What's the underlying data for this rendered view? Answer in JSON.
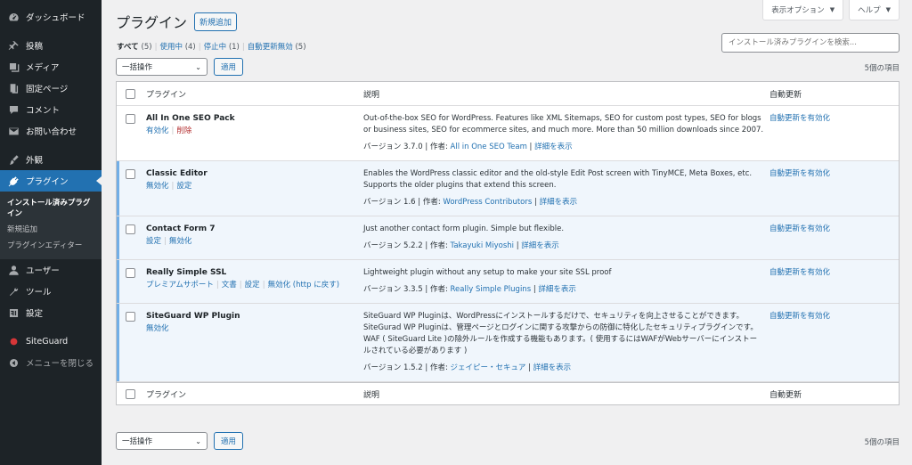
{
  "sidebar": {
    "items": [
      {
        "label": "ダッシュボード",
        "icon": "dashboard-icon"
      },
      {
        "label": "投稿",
        "icon": "pin-icon"
      },
      {
        "label": "メディア",
        "icon": "media-icon"
      },
      {
        "label": "固定ページ",
        "icon": "page-icon"
      },
      {
        "label": "コメント",
        "icon": "comment-icon"
      },
      {
        "label": "お問い合わせ",
        "icon": "mail-icon"
      },
      {
        "label": "外観",
        "icon": "brush-icon"
      },
      {
        "label": "プラグイン",
        "icon": "plugin-icon"
      },
      {
        "label": "ユーザー",
        "icon": "user-icon"
      },
      {
        "label": "ツール",
        "icon": "wrench-icon"
      },
      {
        "label": "設定",
        "icon": "settings-icon"
      },
      {
        "label": "SiteGuard",
        "icon": "siteguard-icon"
      },
      {
        "label": "メニューを閉じる",
        "icon": "collapse-icon"
      }
    ],
    "submenu": [
      "インストール済みプラグイン",
      "新規追加",
      "プラグインエディター"
    ]
  },
  "header": {
    "screen_options": "表示オプション",
    "help": "ヘルプ",
    "title": "プラグイン",
    "add_new": "新規追加"
  },
  "filters": {
    "all": "すべて",
    "all_count": "(5)",
    "active": "使用中",
    "active_count": "(4)",
    "inactive": "停止中",
    "inactive_count": "(1)",
    "auto_disabled": "自動更新無効",
    "auto_disabled_count": "(5)"
  },
  "search": {
    "placeholder": "インストール済みプラグインを検索..."
  },
  "tablenav": {
    "bulk_action": "一括操作",
    "apply": "適用",
    "item_count": "5個の項目"
  },
  "table": {
    "headers": {
      "plugin": "プラグイン",
      "description": "説明",
      "auto_update": "自動更新"
    },
    "rows": [
      {
        "name": "All In One SEO Pack",
        "actions": [
          "有効化",
          "削除"
        ],
        "description": "Out-of-the-box SEO for WordPress. Features like XML Sitemaps, SEO for custom post types, SEO for blogs or business sites, SEO for ecommerce sites, and much more. More than 50 million downloads since 2007.",
        "version": "バージョン 3.7.0",
        "author_label": "作者:",
        "author": "All in One SEO Team",
        "details": "詳細を表示",
        "auto_update": "自動更新を有効化"
      },
      {
        "name": "Classic Editor",
        "actions": [
          "無効化",
          "設定"
        ],
        "description": "Enables the WordPress classic editor and the old-style Edit Post screen with TinyMCE, Meta Boxes, etc. Supports the older plugins that extend this screen.",
        "version": "バージョン 1.6",
        "author_label": "作者:",
        "author": "WordPress Contributors",
        "details": "詳細を表示",
        "auto_update": "自動更新を有効化"
      },
      {
        "name": "Contact Form 7",
        "actions": [
          "設定",
          "無効化"
        ],
        "description": "Just another contact form plugin. Simple but flexible.",
        "version": "バージョン 5.2.2",
        "author_label": "作者:",
        "author": "Takayuki Miyoshi",
        "details": "詳細を表示",
        "auto_update": "自動更新を有効化"
      },
      {
        "name": "Really Simple SSL",
        "actions": [
          "プレミアムサポート",
          "文書",
          "設定",
          "無効化 (http に戻す)"
        ],
        "description": "Lightweight plugin without any setup to make your site SSL proof",
        "version": "バージョン 3.3.5",
        "author_label": "作者:",
        "author": "Really Simple Plugins",
        "details": "詳細を表示",
        "auto_update": "自動更新を有効化"
      },
      {
        "name": "SiteGuard WP Plugin",
        "actions": [
          "無効化"
        ],
        "description": "SiteGuard WP Pluginは、WordPressにインストールするだけで、セキュリティを向上させることができます。SiteGurad WP Pluginは、管理ページとログインに関する攻撃からの防御に特化したセキュリティプラグインです。WAF ( SiteGuard Lite )の除外ルールを作成する機能もあります。( 使用するにはWAFがWebサーバーにインストールされている必要があります )",
        "version": "バージョン 1.5.2",
        "author_label": "作者:",
        "author": "ジェイピー・セキュア",
        "details": "詳細を表示",
        "auto_update": "自動更新を有効化"
      }
    ]
  }
}
